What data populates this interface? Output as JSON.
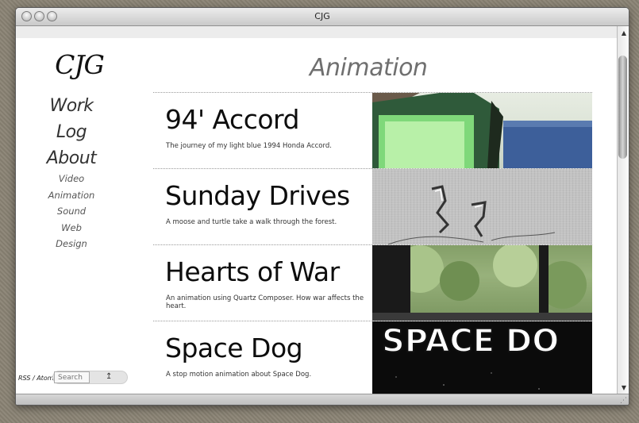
{
  "window": {
    "title": "CJG"
  },
  "sidebar": {
    "logo": "CJG",
    "main_nav": [
      "Work",
      "Log",
      "About"
    ],
    "sub_nav": [
      "Video",
      "Animation",
      "Sound",
      "Web",
      "Design"
    ]
  },
  "footer": {
    "rss_label": "RSS / Atom",
    "search_placeholder": "Search",
    "search_button": "↥"
  },
  "main": {
    "section_title": "Animation",
    "items": [
      {
        "title": "94' Accord",
        "description": "The journey of my light blue 1994 Honda Accord."
      },
      {
        "title": "Sunday Drives",
        "description": "A moose and turtle take a walk through the forest."
      },
      {
        "title": "Hearts of War",
        "description": "An animation using Quartz Composer. How war affects the heart."
      },
      {
        "title": "Space Dog",
        "description": "A stop motion animation about Space Dog.",
        "thumb_text": "SPACE DO"
      }
    ]
  },
  "colors": {
    "section_title": "#6f6f6f",
    "nav": "#333333",
    "window_bg": "#ffffff"
  }
}
